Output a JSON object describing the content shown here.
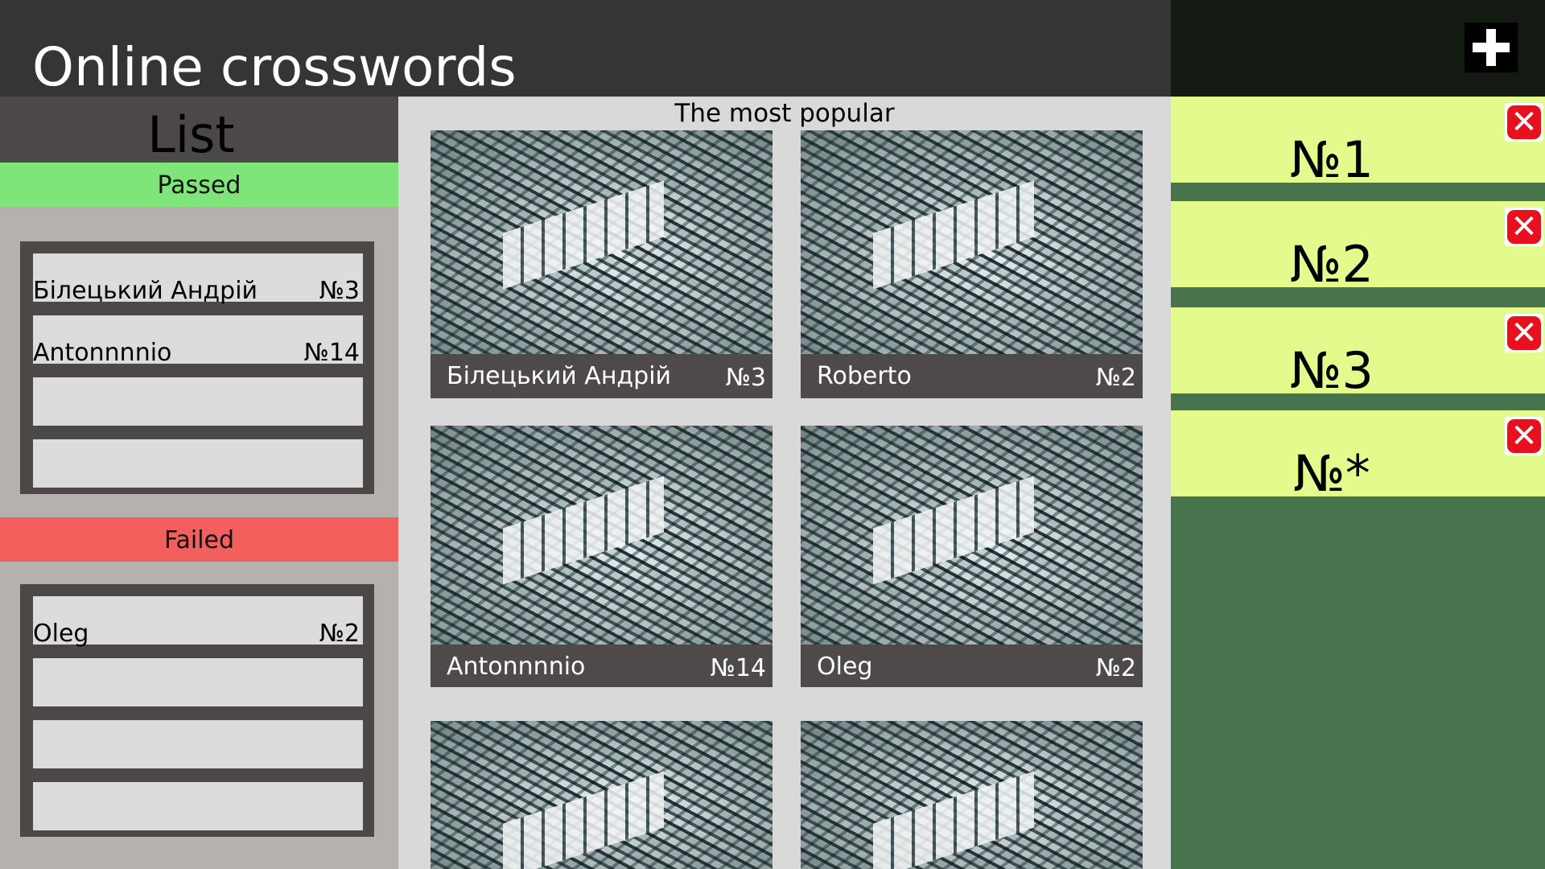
{
  "header": {
    "title": "Online crosswords",
    "add_icon": "plus-icon"
  },
  "sidebar": {
    "title": "List",
    "passed": {
      "label": "Passed",
      "color": "#7fe57a",
      "entries": [
        {
          "name": "Білецький Андрій",
          "num": "№3"
        },
        {
          "name": "Antonnnnio",
          "num": "№14"
        },
        {
          "name": "",
          "num": ""
        },
        {
          "name": "",
          "num": ""
        }
      ]
    },
    "failed": {
      "label": "Failed",
      "color": "#f25f5c",
      "entries": [
        {
          "name": "Oleg",
          "num": "№2"
        },
        {
          "name": "",
          "num": ""
        },
        {
          "name": "",
          "num": ""
        },
        {
          "name": "",
          "num": ""
        }
      ]
    }
  },
  "main": {
    "title": "The most popular",
    "cards": [
      {
        "name": "Білецький Андрій",
        "num": "№3"
      },
      {
        "name": "Roberto",
        "num": "№2"
      },
      {
        "name": "Antonnnnio",
        "num": "№14"
      },
      {
        "name": "Oleg",
        "num": "№2"
      },
      {
        "name": "",
        "num": ""
      },
      {
        "name": "",
        "num": ""
      }
    ]
  },
  "right_panel": {
    "slots": [
      {
        "label": "№1",
        "close_icon": "close-icon"
      },
      {
        "label": "№2",
        "close_icon": "close-icon"
      },
      {
        "label": "№3",
        "close_icon": "close-icon"
      },
      {
        "label": "№*",
        "close_icon": "close-icon"
      }
    ]
  }
}
